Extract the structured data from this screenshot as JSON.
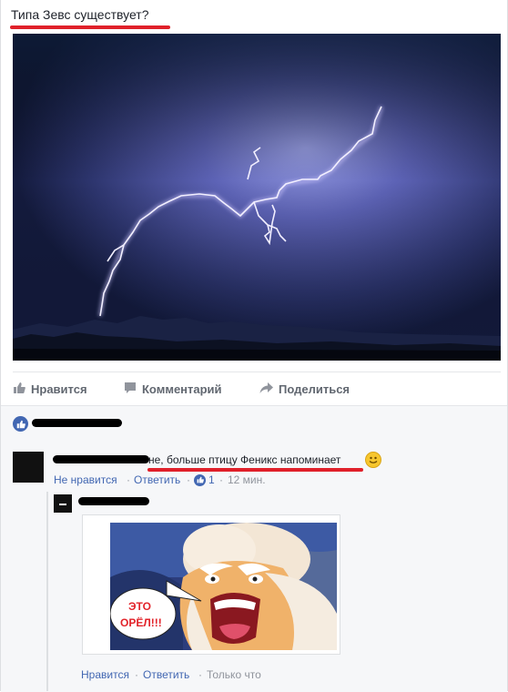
{
  "post": {
    "text": "Типа Зевс существует?"
  },
  "actions": {
    "like": "Нравится",
    "comment": "Комментарий",
    "share": "Поделиться"
  },
  "comment": {
    "text": "не, больше птицу Феникс напоминает",
    "unlike": "Не нравится",
    "reply": "Ответить",
    "like_count": "1",
    "time": "12 мин."
  },
  "reply": {
    "meme_text_line1": "ЭТО",
    "meme_text_line2": "ОРЁЛ!!!",
    "like": "Нравится",
    "reply": "Ответить",
    "time": "Только что"
  },
  "colors": {
    "accent": "#4267b2",
    "highlight": "#e0202a",
    "muted": "#90949c"
  },
  "icons": [
    "thumbs-up-icon",
    "comment-icon",
    "share-icon",
    "smiley-icon"
  ]
}
